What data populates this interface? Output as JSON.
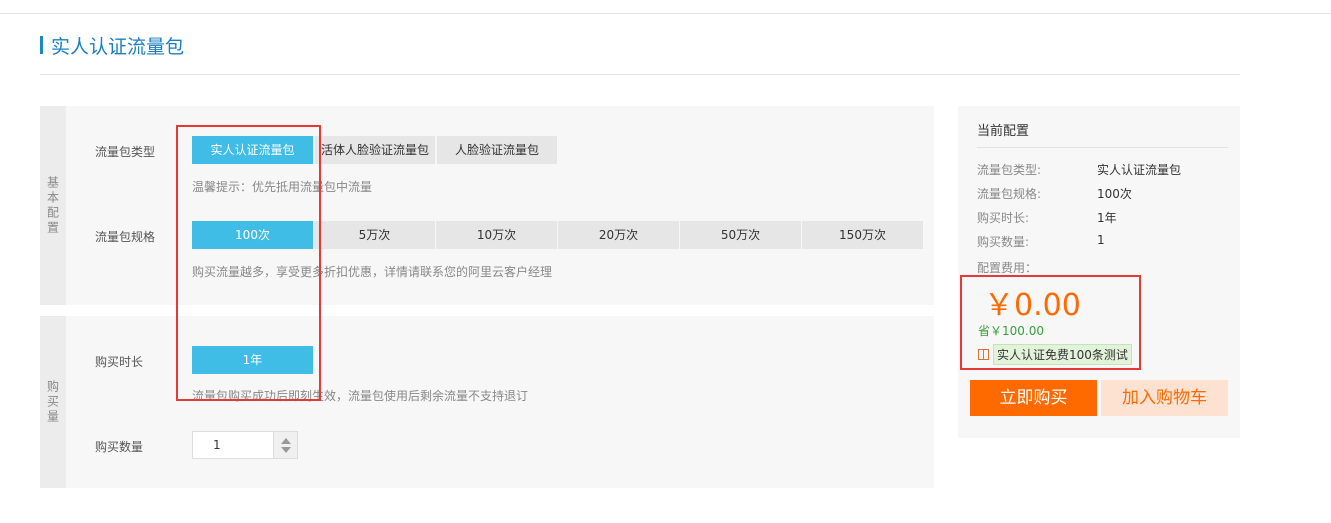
{
  "page": {
    "title": "实人认证流量包"
  },
  "basic_section": {
    "label": "基本配置",
    "type_row": {
      "label": "流量包类型",
      "options": [
        "实人认证流量包",
        "活体人脸验证流量包",
        "人脸验证流量包"
      ],
      "selected": "实人认证流量包",
      "hint": "温馨提示：优先抵用流量包中流量"
    },
    "spec_row": {
      "label": "流量包规格",
      "options": [
        "100次",
        "5万次",
        "10万次",
        "20万次",
        "50万次",
        "150万次"
      ],
      "selected": "100次",
      "hint": "购买流量越多，享受更多折扣优惠，详情请联系您的阿里云客户经理"
    }
  },
  "purchase_section": {
    "label": "购买量",
    "duration_row": {
      "label": "购买时长",
      "options": [
        "1年"
      ],
      "selected": "1年",
      "hint": "流量包购买成功后即刻生效，流量包使用后剩余流量不支持退订"
    },
    "quantity_row": {
      "label": "购买数量",
      "value": "1"
    }
  },
  "summary": {
    "title": "当前配置",
    "items": [
      {
        "key": "流量包类型:",
        "value": "实人认证流量包"
      },
      {
        "key": "流量包规格:",
        "value": "100次"
      },
      {
        "key": "购买时长:",
        "value": "1年"
      },
      {
        "key": "购买数量:",
        "value": "1"
      }
    ],
    "fee_label": "配置费用：",
    "price": "￥0.00",
    "savings": "省￥100.00",
    "promo": "实人认证免费100条测试",
    "buy_button": "立即购买",
    "cart_button": "加入购物车"
  },
  "colors": {
    "accent": "#3fbde6",
    "orange": "#ff6a00",
    "highlight": "#e53935",
    "title": "#1a7fc1"
  },
  "icons": [
    "gift-icon",
    "chevron-up-icon",
    "chevron-down-icon"
  ]
}
